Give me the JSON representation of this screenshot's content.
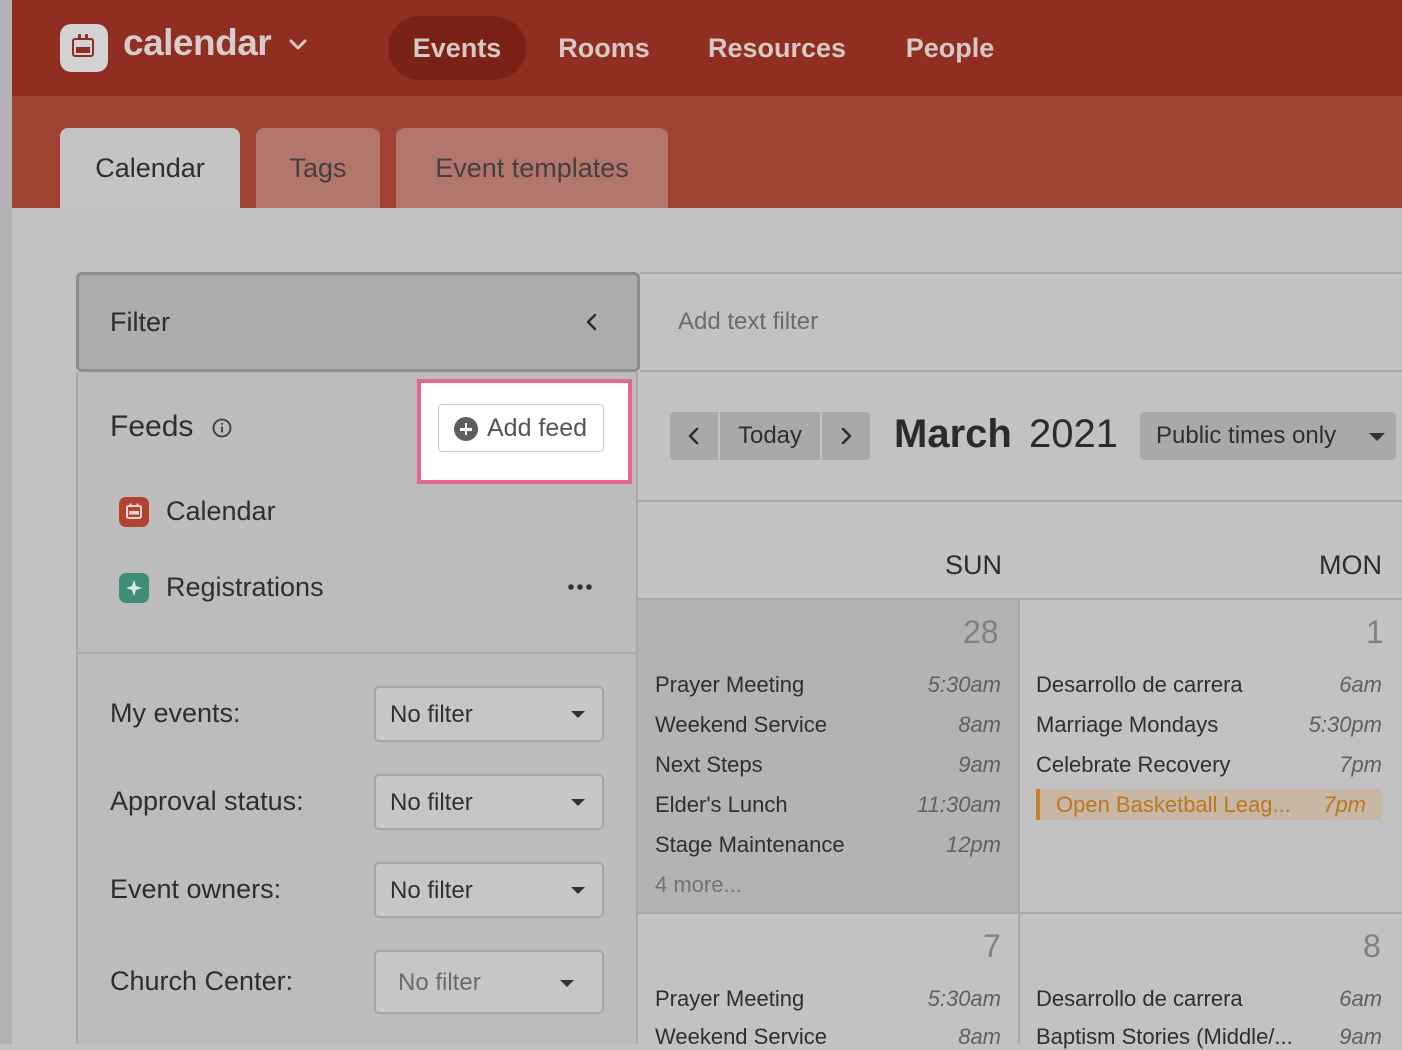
{
  "app": {
    "name": "calendar",
    "logo_icon": "calendar-icon"
  },
  "nav": {
    "items": [
      {
        "label": "Events",
        "active": true
      },
      {
        "label": "Rooms",
        "active": false
      },
      {
        "label": "Resources",
        "active": false
      },
      {
        "label": "People",
        "active": false
      }
    ]
  },
  "tabs": [
    {
      "label": "Calendar",
      "active": true
    },
    {
      "label": "Tags",
      "active": false
    },
    {
      "label": "Event templates",
      "active": false
    }
  ],
  "filter": {
    "title": "Filter",
    "feeds_title": "Feeds",
    "add_feed_label": "Add feed",
    "feeds": [
      {
        "label": "Calendar",
        "icon": "calendar-icon",
        "color": "#b34233"
      },
      {
        "label": "Registrations",
        "icon": "registrations-icon",
        "color": "#3f8c78"
      }
    ],
    "fields": [
      {
        "label": "My events:",
        "value": "No filter"
      },
      {
        "label": "Approval status:",
        "value": "No filter"
      },
      {
        "label": "Event owners:",
        "value": "No filter"
      },
      {
        "label": "Church Center:",
        "value": "No filter"
      }
    ]
  },
  "search": {
    "placeholder": "Add text filter"
  },
  "toolbar": {
    "today_label": "Today",
    "month": "March",
    "year": "2021",
    "view_select": "Public times only"
  },
  "calendar": {
    "days_of_week": [
      "SUN",
      "MON"
    ],
    "weeks": [
      {
        "days": [
          {
            "date": "28",
            "events": [
              {
                "name": "Prayer Meeting",
                "time": "5:30am"
              },
              {
                "name": "Weekend Service",
                "time": "8am"
              },
              {
                "name": "Next Steps",
                "time": "9am"
              },
              {
                "name": "Elder's Lunch",
                "time": "11:30am"
              },
              {
                "name": "Stage Maintenance",
                "time": "12pm"
              }
            ],
            "more": "4 more..."
          },
          {
            "date": "1",
            "events": [
              {
                "name": "Desarrollo de carrera",
                "time": "6am"
              },
              {
                "name": "Marriage Mondays",
                "time": "5:30pm"
              },
              {
                "name": "Celebrate Recovery",
                "time": "7pm"
              }
            ],
            "highlighted_event": {
              "name": "Open Basketball Leag...",
              "time": "7pm",
              "color": "#c2822a"
            }
          }
        ]
      },
      {
        "days": [
          {
            "date": "7",
            "events": [
              {
                "name": "Prayer Meeting",
                "time": "5:30am"
              },
              {
                "name": "Weekend Service",
                "time": "8am"
              }
            ]
          },
          {
            "date": "8",
            "events": [
              {
                "name": "Desarrollo de carrera",
                "time": "6am"
              },
              {
                "name": "Baptism Stories (Middle/...",
                "time": "9am"
              }
            ]
          }
        ]
      }
    ]
  },
  "colors": {
    "brand": "#8f2e21",
    "highlight_border": "#e26593",
    "event_orange": "#c2822a"
  }
}
